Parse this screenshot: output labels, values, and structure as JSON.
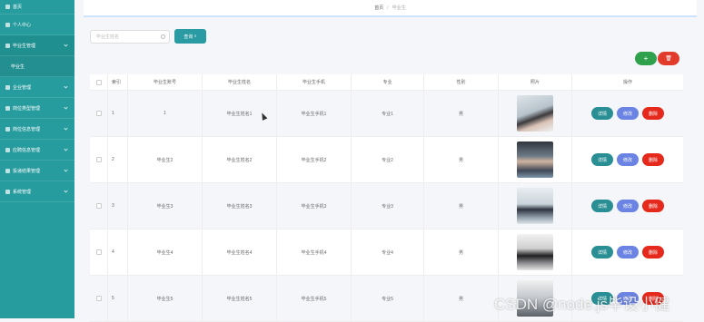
{
  "sidebar": {
    "items": [
      {
        "label": "首页",
        "icon": "home-icon"
      },
      {
        "label": "个人中心",
        "icon": "user-icon"
      },
      {
        "label": "毕业生管理",
        "icon": "graduate-icon"
      },
      {
        "label": "毕业生",
        "icon": ""
      },
      {
        "label": "企业管理",
        "icon": "company-icon"
      },
      {
        "label": "岗位类型管理",
        "icon": "category-icon"
      },
      {
        "label": "岗位信息管理",
        "icon": "job-icon"
      },
      {
        "label": "应聘信息管理",
        "icon": "apply-icon"
      },
      {
        "label": "投递结果管理",
        "icon": "result-icon"
      },
      {
        "label": "系统管理",
        "icon": "system-icon"
      }
    ]
  },
  "breadcrumb": {
    "home": "首页",
    "current": "毕业生"
  },
  "search": {
    "placeholder": "毕业生姓名",
    "button_label": "查询"
  },
  "toolbar": {
    "add_label": "+",
    "delete_label": "🗑"
  },
  "table": {
    "headers": [
      "索引",
      "毕业生账号",
      "毕业生姓名",
      "毕业生手机",
      "专业",
      "性别",
      "照片",
      "操作"
    ],
    "rows": [
      {
        "index": "1",
        "account": "1",
        "name": "毕业生姓名1",
        "phone": "毕业生手机1",
        "major": "专业1",
        "gender": "男"
      },
      {
        "index": "2",
        "account": "毕业生2",
        "name": "毕业生姓名2",
        "phone": "毕业生手机2",
        "major": "专业2",
        "gender": "男"
      },
      {
        "index": "3",
        "account": "毕业生3",
        "name": "毕业生姓名3",
        "phone": "毕业生手机3",
        "major": "专业3",
        "gender": "男"
      },
      {
        "index": "4",
        "account": "毕业生4",
        "name": "毕业生姓名4",
        "phone": "毕业生手机4",
        "major": "专业4",
        "gender": "男"
      },
      {
        "index": "5",
        "account": "毕业生5",
        "name": "毕业生姓名5",
        "phone": "毕业生手机5",
        "major": "专业5",
        "gender": "男"
      }
    ],
    "actions": {
      "detail": "详情",
      "edit": "修改",
      "delete": "删除"
    }
  },
  "watermark": "CSDN @node.js毕设小健",
  "colors": {
    "sidebar": "#279c9e",
    "detail": "#2a8f94",
    "edit": "#6b84e3",
    "delete": "#e5291d",
    "add": "#2fa04b"
  }
}
